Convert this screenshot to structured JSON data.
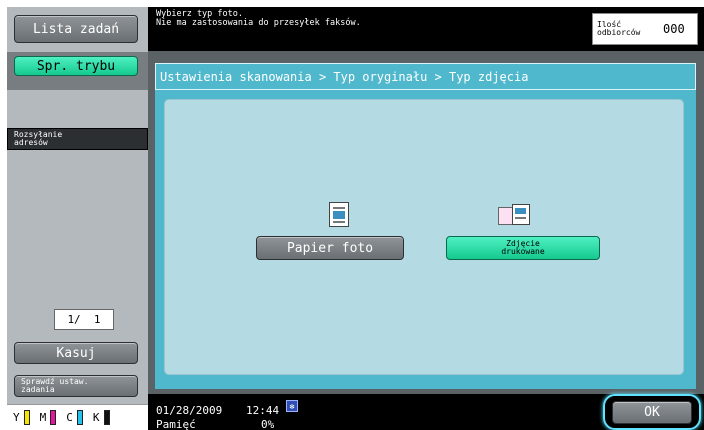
{
  "left_panel": {
    "job_list_label": "Lista zadań",
    "mode_check_label": "Spr. trybu",
    "address_broadcast_label": "Rozsyłanie adresów",
    "page_counter": "1/  1",
    "delete_label": "Kasuj",
    "check_settings_label": "Sprawdź ustaw. zadania"
  },
  "top_bar": {
    "message_line1": "Wybierz typ foto.",
    "message_line2": "Nie ma zastosowania do przesyłek faksów.",
    "recipients_label": "Ilość odbiorców",
    "recipients_count": "000"
  },
  "main": {
    "breadcrumb": "Ustawienia skanowania > Typ oryginału > Typ zdjęcia",
    "options": [
      {
        "label": "Papier foto",
        "icon": "photo-paper-icon",
        "selected": false
      },
      {
        "label": "Zdjęcie drukowane",
        "icon": "printed-photo-icon",
        "selected": true
      }
    ]
  },
  "bottom_bar": {
    "date": "01/28/2009",
    "time": "12:44",
    "memory_label": "Pamięć",
    "memory_value": "0%",
    "ok_label": "OK"
  },
  "toner": [
    {
      "label": "Y",
      "color": "#f3e600"
    },
    {
      "label": "M",
      "color": "#e0179b"
    },
    {
      "label": "C",
      "color": "#27c0e8"
    },
    {
      "label": "K",
      "color": "#111111"
    }
  ],
  "colors": {
    "accent_green": "#14c98e",
    "panel_blue": "#4fb8cd",
    "selection_ring": "#5fe3ff"
  }
}
